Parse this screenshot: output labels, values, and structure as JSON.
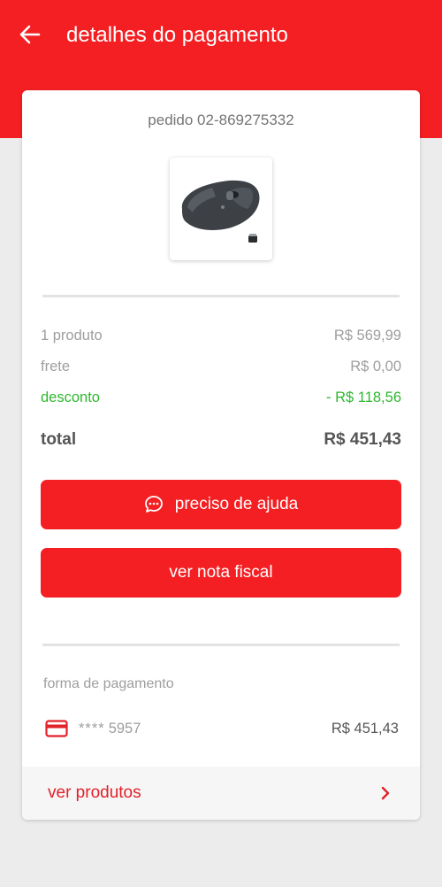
{
  "header": {
    "title": "detalhes do pagamento",
    "back_icon": "arrow-left-icon",
    "color": "#f41f22"
  },
  "order": {
    "id_label": "pedido 02-869275332",
    "product_image": "wireless-mouse-with-usb-receiver"
  },
  "summary": {
    "products_label": "1 produto",
    "products_value": "R$ 569,99",
    "shipping_label": "frete",
    "shipping_value": "R$ 0,00",
    "discount_label": "desconto",
    "discount_value": "- R$ 118,56",
    "discount_color": "#2eb82e",
    "total_label": "total",
    "total_value": "R$ 451,43"
  },
  "actions": {
    "help_label": "preciso de ajuda",
    "help_icon": "chat-bubble-icon",
    "invoice_label": "ver nota fiscal"
  },
  "payment": {
    "section_label": "forma de pagamento",
    "card_icon": "credit-card-icon",
    "card_mask": "****",
    "card_last4": "5957",
    "amount": "R$ 451,43"
  },
  "footer": {
    "label": "ver produtos",
    "icon": "chevron-right-icon"
  }
}
